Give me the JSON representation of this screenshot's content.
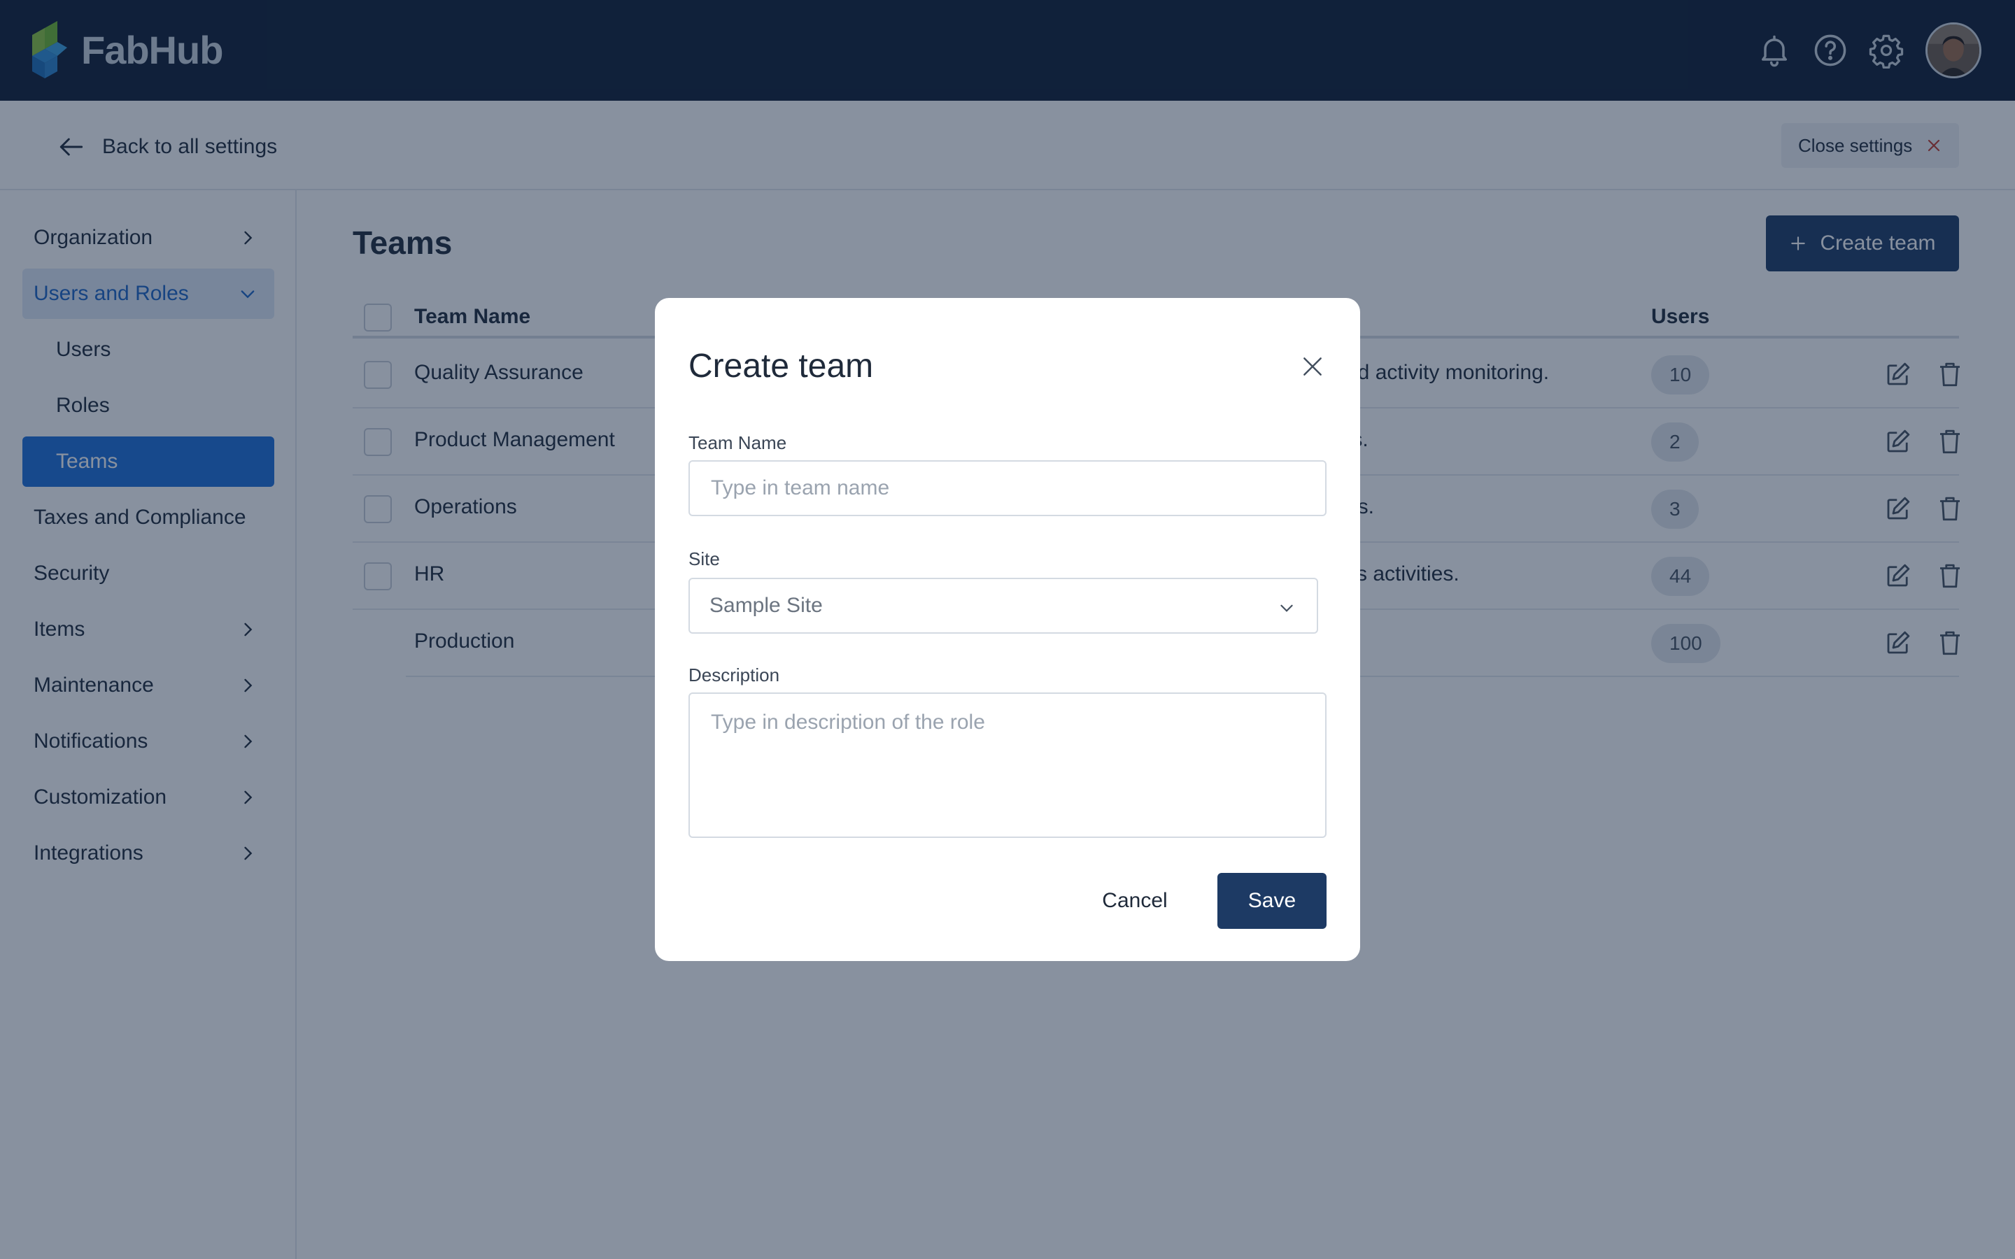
{
  "app": {
    "name": "FabHub"
  },
  "topbar": {
    "icons": [
      "bell-icon",
      "help-icon",
      "gear-icon"
    ],
    "avatar": "user-avatar"
  },
  "settings_header": {
    "back_label": "Back to all settings",
    "close_label": "Close settings"
  },
  "sidebar": {
    "items": [
      {
        "label": "Organization",
        "has_chevron": "right"
      },
      {
        "label": "Users and Roles",
        "has_chevron": "down",
        "state": "open"
      },
      {
        "label": "Users",
        "sub": true
      },
      {
        "label": "Roles",
        "sub": true
      },
      {
        "label": "Teams",
        "sub": true,
        "state": "active"
      },
      {
        "label": "Taxes and Compliance"
      },
      {
        "label": "Security"
      },
      {
        "label": "Items",
        "has_chevron": "right"
      },
      {
        "label": "Maintenance",
        "has_chevron": "right"
      },
      {
        "label": "Notifications",
        "has_chevron": "right"
      },
      {
        "label": "Customization",
        "has_chevron": "right"
      },
      {
        "label": "Integrations",
        "has_chevron": "right"
      }
    ]
  },
  "main": {
    "title": "Teams",
    "create_button": "Create team",
    "table": {
      "columns": {
        "name": "Team Name",
        "users": "Users"
      },
      "rows": [
        {
          "name": "Quality Assurance",
          "desc_visible": "nd activity monitoring.",
          "users": "10"
        },
        {
          "name": "Product Management",
          "desc_visible": "ts.",
          "users": "2"
        },
        {
          "name": "Operations",
          "desc_visible": "es.",
          "users": "3"
        },
        {
          "name": "HR",
          "desc_visible": "ks activities.",
          "users": "44"
        },
        {
          "name": "Production",
          "desc_visible": "",
          "users": "100"
        }
      ]
    }
  },
  "modal": {
    "title": "Create team",
    "team_name_label": "Team Name",
    "team_name_placeholder": "Type in team name",
    "team_name_value": "",
    "site_label": "Site",
    "site_value": "Sample Site",
    "description_label": "Description",
    "description_placeholder": "Type in description of the role",
    "cancel_label": "Cancel",
    "save_label": "Save"
  },
  "colors": {
    "topbar": "#0f1d35",
    "accent": "#1c6fd8",
    "primary_button": "#1d3a64",
    "overlay": "#11243f"
  }
}
